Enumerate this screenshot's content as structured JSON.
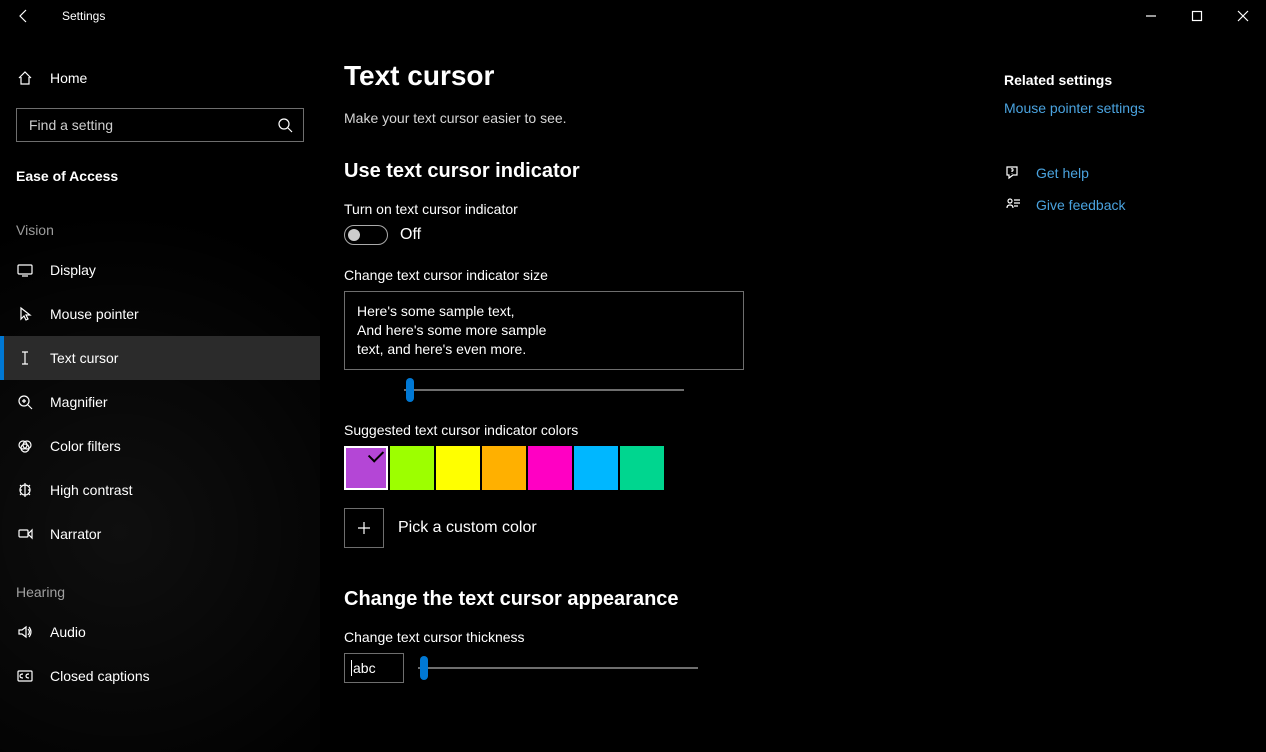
{
  "titlebar": {
    "title": "Settings"
  },
  "sidebar": {
    "home": "Home",
    "search_placeholder": "Find a setting",
    "section": "Ease of Access",
    "groups": [
      {
        "title": "Vision",
        "items": [
          {
            "label": "Display",
            "icon": "display-icon"
          },
          {
            "label": "Mouse pointer",
            "icon": "mouse-pointer-icon"
          },
          {
            "label": "Text cursor",
            "icon": "text-cursor-icon",
            "selected": true
          },
          {
            "label": "Magnifier",
            "icon": "magnifier-icon"
          },
          {
            "label": "Color filters",
            "icon": "color-filters-icon"
          },
          {
            "label": "High contrast",
            "icon": "high-contrast-icon"
          },
          {
            "label": "Narrator",
            "icon": "narrator-icon"
          }
        ]
      },
      {
        "title": "Hearing",
        "items": [
          {
            "label": "Audio",
            "icon": "audio-icon"
          },
          {
            "label": "Closed captions",
            "icon": "closed-captions-icon"
          }
        ]
      }
    ]
  },
  "main": {
    "title": "Text cursor",
    "subtitle": "Make your text cursor easier to see.",
    "section1_heading": "Use text cursor indicator",
    "toggle_label": "Turn on text cursor indicator",
    "toggle_state": "Off",
    "size_label": "Change text cursor indicator size",
    "sample_line1": "Here's some sample text,",
    "sample_line2": "And here's some more sample",
    "sample_line3": "text, and here's even more.",
    "colors_label": "Suggested text cursor indicator colors",
    "colors": [
      "#b446d6",
      "#9dff00",
      "#ffff00",
      "#ffb000",
      "#ff00c3",
      "#00b7ff",
      "#00d68f"
    ],
    "selected_color_index": 0,
    "custom_color_label": "Pick a custom color",
    "section2_heading": "Change the text cursor appearance",
    "thickness_label": "Change text cursor thickness",
    "thickness_sample": "abc"
  },
  "side": {
    "related_heading": "Related settings",
    "related_link": "Mouse pointer settings",
    "help": "Get help",
    "feedback": "Give feedback"
  }
}
